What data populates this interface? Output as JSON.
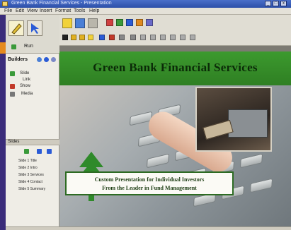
{
  "window": {
    "title": "Green Bank Financial Services - Presentation"
  },
  "menu": {
    "items": [
      "File",
      "Edit",
      "View",
      "Insert",
      "Format",
      "Tools",
      "Help"
    ]
  },
  "left_panel": {
    "top_label": "Run",
    "section_label": "Builders",
    "tree": [
      "Slide",
      "Link",
      "Show",
      "Media"
    ],
    "bottom_section_label": "Slides",
    "slide_list": [
      "Slide 1 Title",
      "Slide 2 Intro",
      "Slide 3 Services",
      "Slide 4 Contact",
      "Slide 5 Summary"
    ]
  },
  "toolbar": {
    "icons": [
      "open-icon",
      "save-icon",
      "print-icon",
      "cut-icon",
      "copy-icon",
      "paste-icon",
      "undo-icon",
      "redo-icon",
      "text-icon",
      "pen-icon",
      "shape-icon",
      "color-icon",
      "align-icon",
      "bold-icon",
      "italic-icon",
      "underline-icon"
    ]
  },
  "slide": {
    "title": "Green Bank Financial Services",
    "banner_line1": "Custom Presentation for Individual Investors",
    "banner_line2": "From the Leader in Fund Management"
  },
  "colors": {
    "header_green": "#3c9a2e",
    "tree_green": "#2f8a2a",
    "titlebar": "#2c4fa8",
    "left_strip": "#3a2c7a"
  }
}
